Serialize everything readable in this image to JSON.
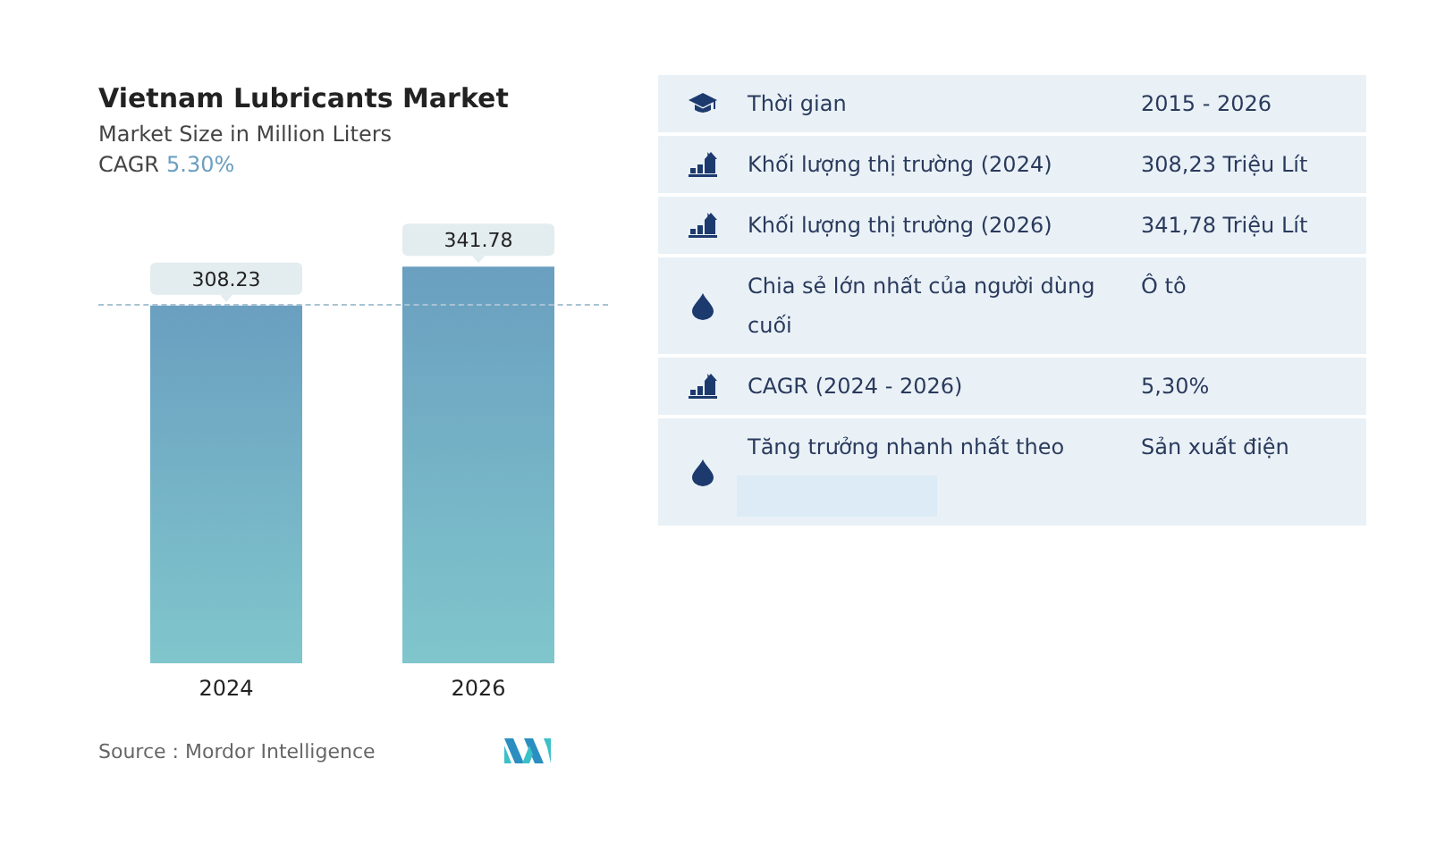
{
  "title": "Vietnam Lubricants Market",
  "subtitle": "Market Size in Million Liters",
  "cagr": {
    "label": "CAGR",
    "value": "5.30%"
  },
  "chart_data": {
    "type": "bar",
    "categories": [
      "2024",
      "2026"
    ],
    "series": [
      {
        "color": "#6a9fc0",
        "values": [
          308.23,
          341.78
        ]
      }
    ],
    "ylim": [
      0,
      342
    ],
    "data_labels": true
  },
  "value_labels": [
    "308.23",
    "341.78"
  ],
  "source": "Source :  Mordor Intelligence",
  "table": [
    {
      "kind": "cap",
      "label": "Thời gian",
      "value": "2015 - 2026"
    },
    {
      "kind": "chart",
      "label": "Khối lượng thị trường (2024)",
      "value": "308,23 Triệu Lít"
    },
    {
      "kind": "chart",
      "label": "Khối lượng thị trường (2026)",
      "value": "341,78 Triệu Lít"
    },
    {
      "kind": "drop",
      "label": "Chia sẻ lớn nhất của người dùng cuối",
      "value": "Ô tô"
    },
    {
      "kind": "chart",
      "label": "CAGR (2024 - 2026)",
      "value": "5,30%"
    },
    {
      "kind": "drop",
      "label": "Tăng trưởng nhanh nhất theo",
      "value": "Sản xuất điện",
      "blank_bar": true
    }
  ]
}
